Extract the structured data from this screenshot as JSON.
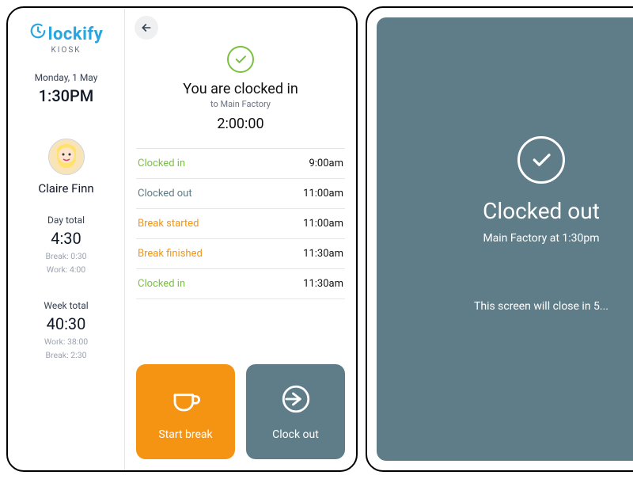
{
  "colors": {
    "brand": "#29a6df",
    "green": "#7ac142",
    "orange": "#f59413",
    "slate": "#5e7d88"
  },
  "branding": {
    "name": "lockify",
    "sub": "KIOSK"
  },
  "sidebar": {
    "date": "Monday, 1 May",
    "time": "1:30PM",
    "user": "Claire Finn",
    "day": {
      "label": "Day total",
      "value": "4:30",
      "sub1": "Break: 0:30",
      "sub2": "Work: 4:00"
    },
    "week": {
      "label": "Week total",
      "value": "40:30",
      "sub1": "Work: 38:00",
      "sub2": "Break: 2:30"
    }
  },
  "status": {
    "title": "You are clocked in",
    "sub": "to Main Factory",
    "elapsed": "2:00:00"
  },
  "log": [
    {
      "label": "Clocked in",
      "cls": "in",
      "time": "9:00am"
    },
    {
      "label": "Clocked out",
      "cls": "out",
      "time": "11:00am"
    },
    {
      "label": "Break started",
      "cls": "break",
      "time": "11:00am"
    },
    {
      "label": "Break finished",
      "cls": "break",
      "time": "11:30am"
    },
    {
      "label": "Clocked in",
      "cls": "in",
      "time": "11:30am"
    }
  ],
  "actions": {
    "break": "Start break",
    "out": "Clock out"
  },
  "confirm": {
    "title": "Clocked out",
    "sub": "Main Factory at 1:30pm",
    "closing": "This screen will close in 5..."
  }
}
